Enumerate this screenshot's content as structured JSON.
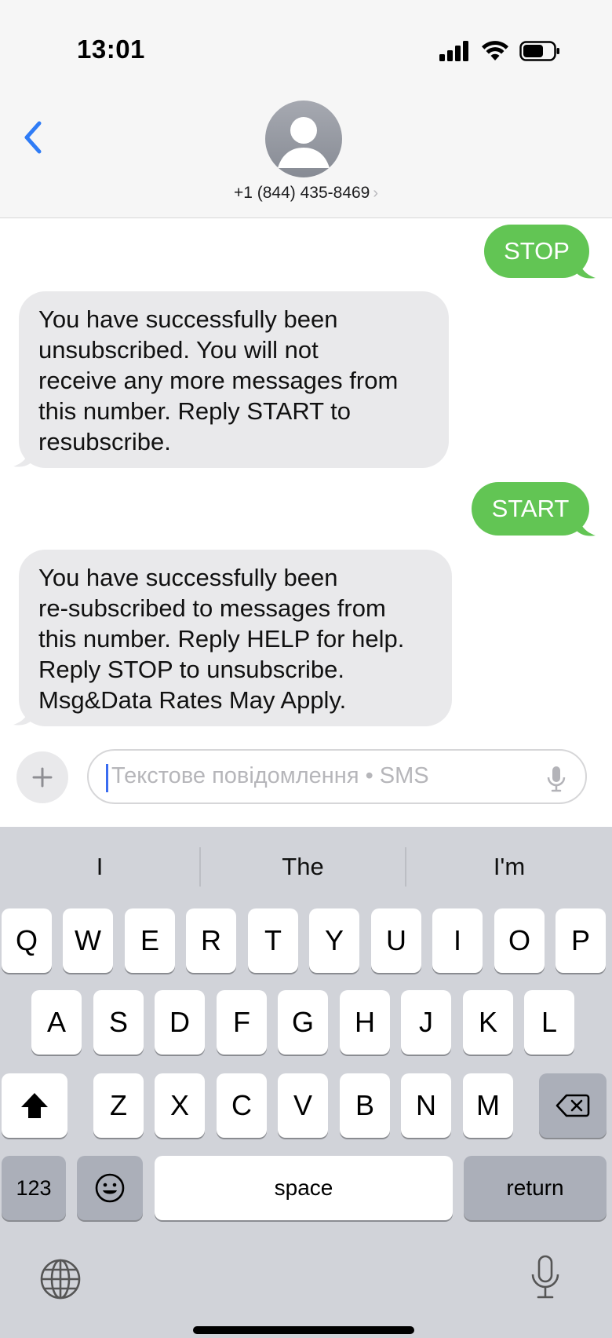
{
  "status_bar": {
    "time": "13:01"
  },
  "header": {
    "contact": "+1 (844) 435-8469",
    "chevron": "›"
  },
  "messages": [
    {
      "direction": "outgoing",
      "text": "STOP"
    },
    {
      "direction": "incoming",
      "lines": [
        "You have successfully been",
        "unsubscribed. You will not",
        "receive any more messages from",
        "this number. Reply START to",
        "resubscribe."
      ]
    },
    {
      "direction": "outgoing",
      "text": "START"
    },
    {
      "direction": "incoming",
      "lines": [
        "You have successfully been",
        "re-subscribed to messages from",
        "this number. Reply HELP for help.",
        "Reply STOP to unsubscribe.",
        "Msg&Data Rates May Apply."
      ]
    }
  ],
  "composer": {
    "placeholder": "Текстове повідомлення • SMS"
  },
  "keyboard": {
    "suggestions": [
      "I",
      "The",
      "I'm"
    ],
    "row1": [
      "Q",
      "W",
      "E",
      "R",
      "T",
      "Y",
      "U",
      "I",
      "O",
      "P"
    ],
    "row2": [
      "A",
      "S",
      "D",
      "F",
      "G",
      "H",
      "J",
      "K",
      "L"
    ],
    "row3": [
      "Z",
      "X",
      "C",
      "V",
      "B",
      "N",
      "M"
    ],
    "numbers_label": "123",
    "space_label": "space",
    "return_label": "return"
  },
  "colors": {
    "outgoing_bubble": "#62c554",
    "incoming_bubble": "#e9e9eb",
    "accent": "#2f7cf6"
  },
  "icons": [
    "back-chevron-icon",
    "signal-icon",
    "wifi-icon",
    "battery-icon",
    "avatar-icon",
    "plus-icon",
    "mic-icon",
    "shift-icon",
    "delete-icon",
    "emoji-icon",
    "globe-icon",
    "dictation-icon"
  ]
}
